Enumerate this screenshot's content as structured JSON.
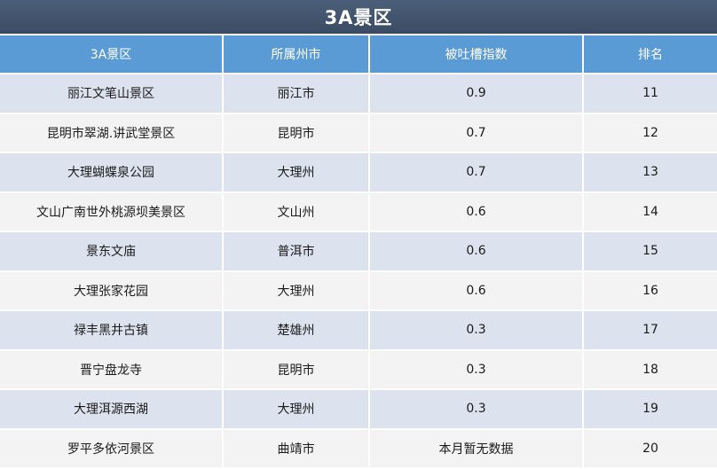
{
  "title": "3A景区",
  "headers": [
    "3A景区",
    "所属州市",
    "被吐槽指数",
    "排名"
  ],
  "rows": [
    {
      "name": "丽江文笔山景区",
      "city": "丽江市",
      "index": "0.9",
      "rank": "11"
    },
    {
      "name": "昆明市翠湖.讲武堂景区",
      "city": "昆明市",
      "index": "0.7",
      "rank": "12"
    },
    {
      "name": "大理蝴蝶泉公园",
      "city": "大理州",
      "index": "0.7",
      "rank": "13"
    },
    {
      "name": "文山广南世外桃源坝美景区",
      "city": "文山州",
      "index": "0.6",
      "rank": "14"
    },
    {
      "name": "景东文庙",
      "city": "普洱市",
      "index": "0.6",
      "rank": "15"
    },
    {
      "name": "大理张家花园",
      "city": "大理州",
      "index": "0.6",
      "rank": "16"
    },
    {
      "name": "禄丰黑井古镇",
      "city": "楚雄州",
      "index": "0.3",
      "rank": "17"
    },
    {
      "name": "晋宁盘龙寺",
      "city": "昆明市",
      "index": "0.3",
      "rank": "18"
    },
    {
      "name": "大理洱源西湖",
      "city": "大理州",
      "index": "0.3",
      "rank": "19"
    },
    {
      "name": "罗平多依河景区",
      "city": "曲靖市",
      "index": "本月暂无数据",
      "rank": "20"
    }
  ],
  "colors": {
    "title_bg": "#44556e",
    "header_bg": "#5b9bd5",
    "row_odd": "#dce3ef",
    "row_even": "#f3f3f3"
  }
}
